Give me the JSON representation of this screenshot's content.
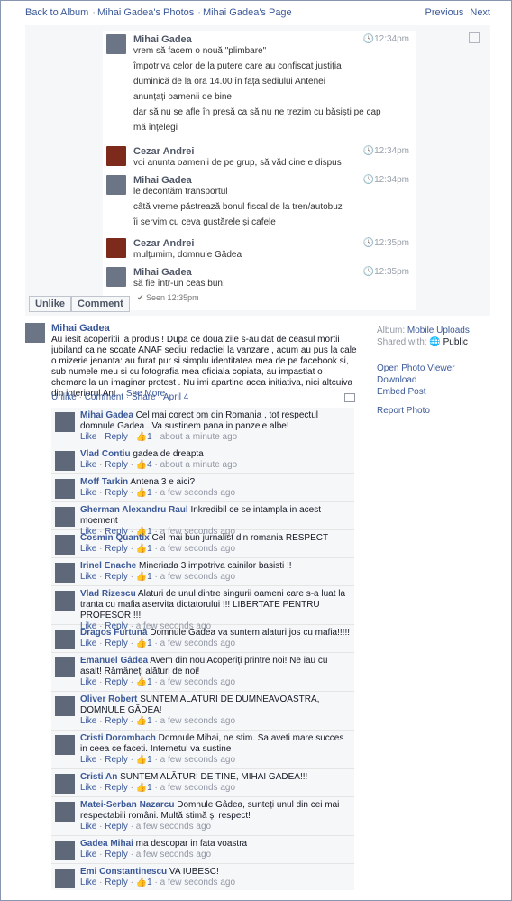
{
  "topnav": {
    "back": "Back to Album",
    "album": "Mihai Gadea's Photos",
    "page": "Mihai Gadea's Page",
    "previous": "Previous",
    "next": "Next"
  },
  "chat": {
    "messages": [
      {
        "name": "Mihai Gadea",
        "time": "12:34pm",
        "red": false,
        "lines": [
          "vrem să facem o nouă \"plimbare\"",
          "împotriva celor de la putere care au confiscat justiția",
          "duminică de la ora 14.00 în fața sediului Antenei",
          "anunțați oamenii de bine",
          "dar să nu se afle în presă ca să nu ne trezim cu băsiști pe cap",
          "mă înțelegi"
        ]
      },
      {
        "name": "Cezar Andrei",
        "time": "12:34pm",
        "red": true,
        "lines": [
          "voi anunța oamenii de pe grup, să văd cine e dispus"
        ]
      },
      {
        "name": "Mihai Gadea",
        "time": "12:34pm",
        "red": false,
        "lines": [
          "le decontăm transportul",
          "câtă vreme păstrează bonul fiscal de la tren/autobuz",
          "îi servim cu ceva gustărele și cafele"
        ]
      },
      {
        "name": "Cezar Andrei",
        "time": "12:35pm",
        "red": true,
        "lines": [
          "mulțumim, domnule Gâdea"
        ]
      },
      {
        "name": "Mihai Gadea",
        "time": "12:35pm",
        "red": false,
        "lines": [
          "să fie într-un ceas bun!"
        ]
      }
    ],
    "seen": "✔ Seen 12:35pm"
  },
  "photo_actions": {
    "unlike": "Unlike",
    "comment": "Comment"
  },
  "post": {
    "author": "Mihai Gadea",
    "text": "Au iesit acoperitii la produs ! Dupa ce doua zile s-au dat de ceasul mortii jubiland ca ne scoate ANAF sediul redactiei la vanzare , acum au pus la cale o mizerie jenanta: au furat pur si simplu identitatea mea de pe facebook si, sub numele meu si cu fotografia mea oficiala copiata, au impastiat o chemare la un imaginar protest . Nu imi apartine acea initiativa, nici altcuiva din interiorul Ant...",
    "see_more": "See More",
    "actions": {
      "unlike": "Unlike",
      "comment": "Comment",
      "share": "Share",
      "date": "April 4"
    }
  },
  "sidebar": {
    "album_label": "Album:",
    "album_value": "Mobile Uploads",
    "shared_label": "Shared with:",
    "shared_value": "Public",
    "links": [
      "Open Photo Viewer",
      "Download",
      "Embed Post",
      "Report Photo"
    ]
  },
  "comments": [
    {
      "name": "Mihai Gadea",
      "text": "Cel mai corect om din Romania , tot respectul domnule Gadea . Va sustinem pana in panzele albe!",
      "likes": "1",
      "time": "about a minute ago"
    },
    {
      "name": "Vlad Contiu",
      "text": "gadea de dreapta",
      "likes": "4",
      "time": "about a minute ago"
    },
    {
      "name": "Moff Tarkin",
      "text": "Antena 3 e aici?",
      "likes": "1",
      "time": "a few seconds ago"
    },
    {
      "name": "Gherman Alexandru Raul",
      "text": "Inkredibil ce se intampla in acest moement",
      "likes": "1",
      "time": "a few seconds ago"
    },
    {
      "name": "Cosmin Quantix",
      "text": "Cel mai bun jurnalist din romania RESPECT",
      "likes": "1",
      "time": "a few seconds ago"
    },
    {
      "name": "Irinel Enache",
      "text": "Mineriada 3 impotriva cainilor basisti !!",
      "likes": "1",
      "time": "a few seconds ago"
    },
    {
      "name": "Vlad Rizescu",
      "text": "Alaturi de unul dintre singurii oameni care s-a luat la tranta cu mafia aservita dictatorului !!! LIBERTATE PENTRU PROFESOR !!!",
      "likes": "",
      "time": "a few seconds ago"
    },
    {
      "name": "Dragos Furtună",
      "text": "Domnule Gadea va suntem alaturi jos cu mafia!!!!!",
      "likes": "1",
      "time": "a few seconds ago"
    },
    {
      "name": "Emanuel Gâdea",
      "text": "Avem din nou Acoperiți printre noi! Ne iau cu asalt! Rămâneți alături de noi!",
      "likes": "1",
      "time": "a few seconds ago"
    },
    {
      "name": "Oliver Robert",
      "text": "SUNTEM ALĂTURI DE DUMNEAVOASTRA, DOMNULE GĂDEA!",
      "likes": "1",
      "time": "a few seconds ago"
    },
    {
      "name": "Cristi Dorombach",
      "text": "Domnule Mihai, ne stim. Sa aveti mare succes in ceea ce faceti. Internetul va sustine",
      "likes": "1",
      "time": "a few seconds ago"
    },
    {
      "name": "Cristi An",
      "text": "SUNTEM ALĂTURI DE TINE, MIHAI GADEA!!!",
      "likes": "1",
      "time": "a few seconds ago"
    },
    {
      "name": "Matei-Serban Nazarcu",
      "text": "Domnule Gâdea, sunteți unul din cei mai respectabili români. Multă stimă și respect!",
      "likes": "",
      "time": "a few seconds ago"
    },
    {
      "name": "Gadea Mihai",
      "text": "ma descopar in fata voastra",
      "likes": "",
      "time": "a few seconds ago"
    },
    {
      "name": "Emi Constantinescu",
      "text": "VA IUBESC!",
      "likes": "1",
      "time": "a few seconds ago"
    }
  ]
}
